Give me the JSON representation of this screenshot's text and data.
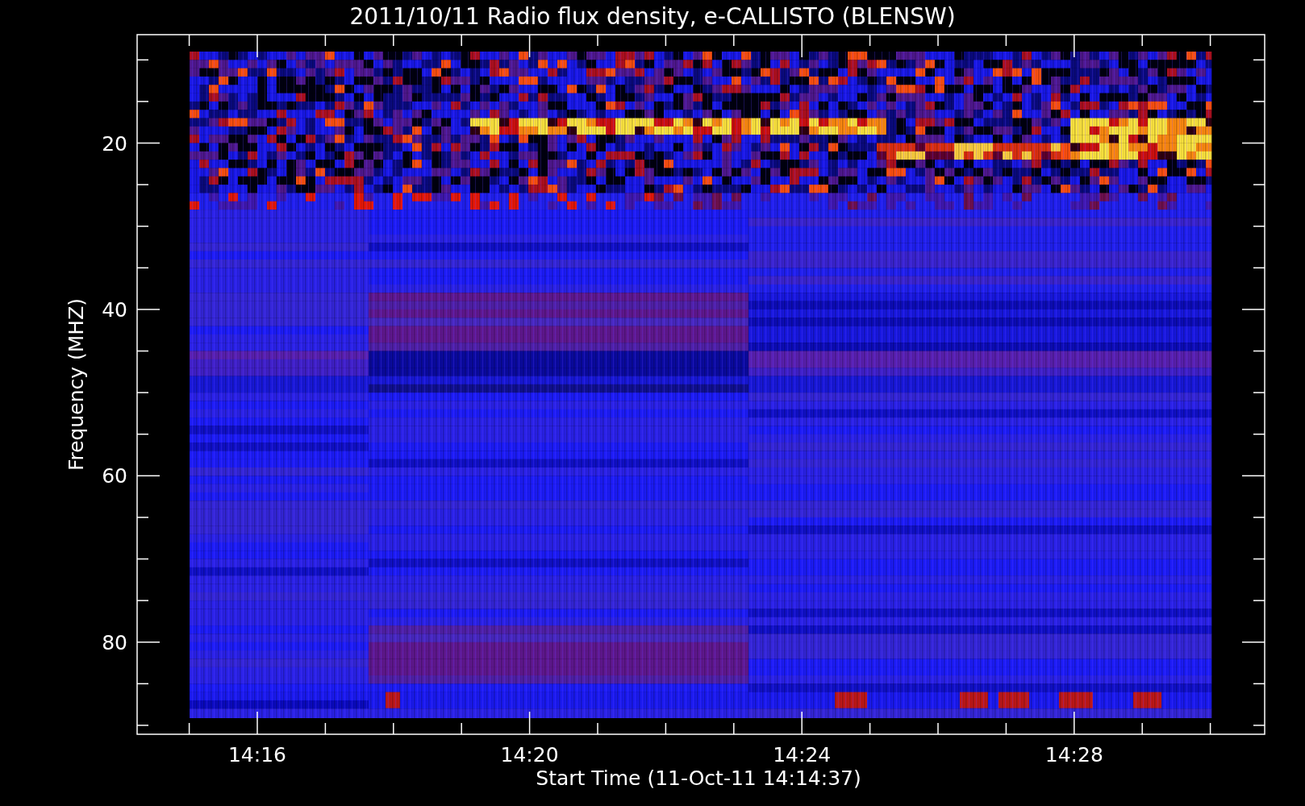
{
  "title": "2011/10/11  Radio flux density, e-CALLISTO (BLENSW)",
  "plot": {
    "ylabel": "Frequency (MHZ)",
    "xlabel": "Start Time (11-Oct-11 14:14:37)",
    "yticks": [
      "20",
      "40",
      "60",
      "80"
    ],
    "xticks": [
      "14:16",
      "14:20",
      "14:24",
      "14:28"
    ]
  }
}
